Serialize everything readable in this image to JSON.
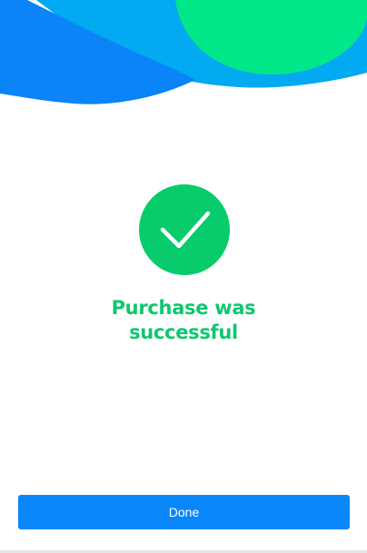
{
  "colors": {
    "wave_dark": "#0a84f6",
    "wave_light": "#03a9f1",
    "blob": "#00e88a",
    "success": "#08cc6c",
    "button": "#0987f8"
  },
  "success": {
    "icon": "checkmark-icon",
    "title_line1": "Purchase was",
    "title_line2": "successful"
  },
  "actions": {
    "done_label": "Done"
  }
}
